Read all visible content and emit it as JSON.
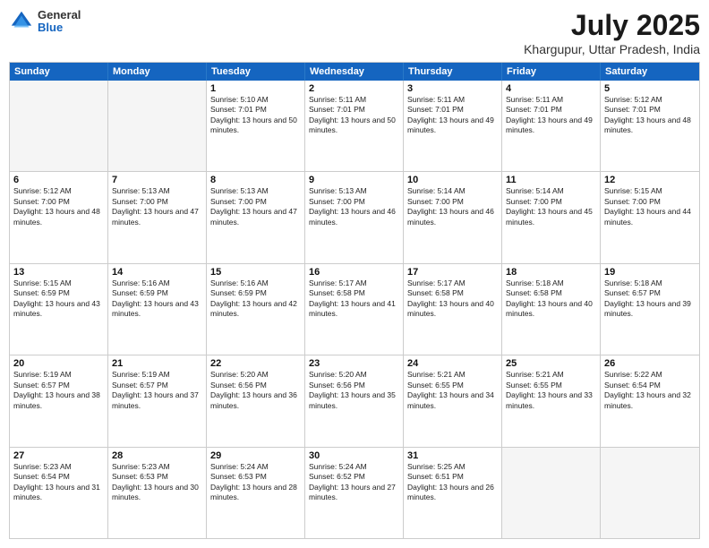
{
  "logo": {
    "general": "General",
    "blue": "Blue"
  },
  "title": "July 2025",
  "subtitle": "Khargupur, Uttar Pradesh, India",
  "headers": [
    "Sunday",
    "Monday",
    "Tuesday",
    "Wednesday",
    "Thursday",
    "Friday",
    "Saturday"
  ],
  "rows": [
    [
      {
        "day": "",
        "info": ""
      },
      {
        "day": "",
        "info": ""
      },
      {
        "day": "1",
        "info": "Sunrise: 5:10 AM\nSunset: 7:01 PM\nDaylight: 13 hours and 50 minutes."
      },
      {
        "day": "2",
        "info": "Sunrise: 5:11 AM\nSunset: 7:01 PM\nDaylight: 13 hours and 50 minutes."
      },
      {
        "day": "3",
        "info": "Sunrise: 5:11 AM\nSunset: 7:01 PM\nDaylight: 13 hours and 49 minutes."
      },
      {
        "day": "4",
        "info": "Sunrise: 5:11 AM\nSunset: 7:01 PM\nDaylight: 13 hours and 49 minutes."
      },
      {
        "day": "5",
        "info": "Sunrise: 5:12 AM\nSunset: 7:01 PM\nDaylight: 13 hours and 48 minutes."
      }
    ],
    [
      {
        "day": "6",
        "info": "Sunrise: 5:12 AM\nSunset: 7:00 PM\nDaylight: 13 hours and 48 minutes."
      },
      {
        "day": "7",
        "info": "Sunrise: 5:13 AM\nSunset: 7:00 PM\nDaylight: 13 hours and 47 minutes."
      },
      {
        "day": "8",
        "info": "Sunrise: 5:13 AM\nSunset: 7:00 PM\nDaylight: 13 hours and 47 minutes."
      },
      {
        "day": "9",
        "info": "Sunrise: 5:13 AM\nSunset: 7:00 PM\nDaylight: 13 hours and 46 minutes."
      },
      {
        "day": "10",
        "info": "Sunrise: 5:14 AM\nSunset: 7:00 PM\nDaylight: 13 hours and 46 minutes."
      },
      {
        "day": "11",
        "info": "Sunrise: 5:14 AM\nSunset: 7:00 PM\nDaylight: 13 hours and 45 minutes."
      },
      {
        "day": "12",
        "info": "Sunrise: 5:15 AM\nSunset: 7:00 PM\nDaylight: 13 hours and 44 minutes."
      }
    ],
    [
      {
        "day": "13",
        "info": "Sunrise: 5:15 AM\nSunset: 6:59 PM\nDaylight: 13 hours and 43 minutes."
      },
      {
        "day": "14",
        "info": "Sunrise: 5:16 AM\nSunset: 6:59 PM\nDaylight: 13 hours and 43 minutes."
      },
      {
        "day": "15",
        "info": "Sunrise: 5:16 AM\nSunset: 6:59 PM\nDaylight: 13 hours and 42 minutes."
      },
      {
        "day": "16",
        "info": "Sunrise: 5:17 AM\nSunset: 6:58 PM\nDaylight: 13 hours and 41 minutes."
      },
      {
        "day": "17",
        "info": "Sunrise: 5:17 AM\nSunset: 6:58 PM\nDaylight: 13 hours and 40 minutes."
      },
      {
        "day": "18",
        "info": "Sunrise: 5:18 AM\nSunset: 6:58 PM\nDaylight: 13 hours and 40 minutes."
      },
      {
        "day": "19",
        "info": "Sunrise: 5:18 AM\nSunset: 6:57 PM\nDaylight: 13 hours and 39 minutes."
      }
    ],
    [
      {
        "day": "20",
        "info": "Sunrise: 5:19 AM\nSunset: 6:57 PM\nDaylight: 13 hours and 38 minutes."
      },
      {
        "day": "21",
        "info": "Sunrise: 5:19 AM\nSunset: 6:57 PM\nDaylight: 13 hours and 37 minutes."
      },
      {
        "day": "22",
        "info": "Sunrise: 5:20 AM\nSunset: 6:56 PM\nDaylight: 13 hours and 36 minutes."
      },
      {
        "day": "23",
        "info": "Sunrise: 5:20 AM\nSunset: 6:56 PM\nDaylight: 13 hours and 35 minutes."
      },
      {
        "day": "24",
        "info": "Sunrise: 5:21 AM\nSunset: 6:55 PM\nDaylight: 13 hours and 34 minutes."
      },
      {
        "day": "25",
        "info": "Sunrise: 5:21 AM\nSunset: 6:55 PM\nDaylight: 13 hours and 33 minutes."
      },
      {
        "day": "26",
        "info": "Sunrise: 5:22 AM\nSunset: 6:54 PM\nDaylight: 13 hours and 32 minutes."
      }
    ],
    [
      {
        "day": "27",
        "info": "Sunrise: 5:23 AM\nSunset: 6:54 PM\nDaylight: 13 hours and 31 minutes."
      },
      {
        "day": "28",
        "info": "Sunrise: 5:23 AM\nSunset: 6:53 PM\nDaylight: 13 hours and 30 minutes."
      },
      {
        "day": "29",
        "info": "Sunrise: 5:24 AM\nSunset: 6:53 PM\nDaylight: 13 hours and 28 minutes."
      },
      {
        "day": "30",
        "info": "Sunrise: 5:24 AM\nSunset: 6:52 PM\nDaylight: 13 hours and 27 minutes."
      },
      {
        "day": "31",
        "info": "Sunrise: 5:25 AM\nSunset: 6:51 PM\nDaylight: 13 hours and 26 minutes."
      },
      {
        "day": "",
        "info": ""
      },
      {
        "day": "",
        "info": ""
      }
    ]
  ]
}
